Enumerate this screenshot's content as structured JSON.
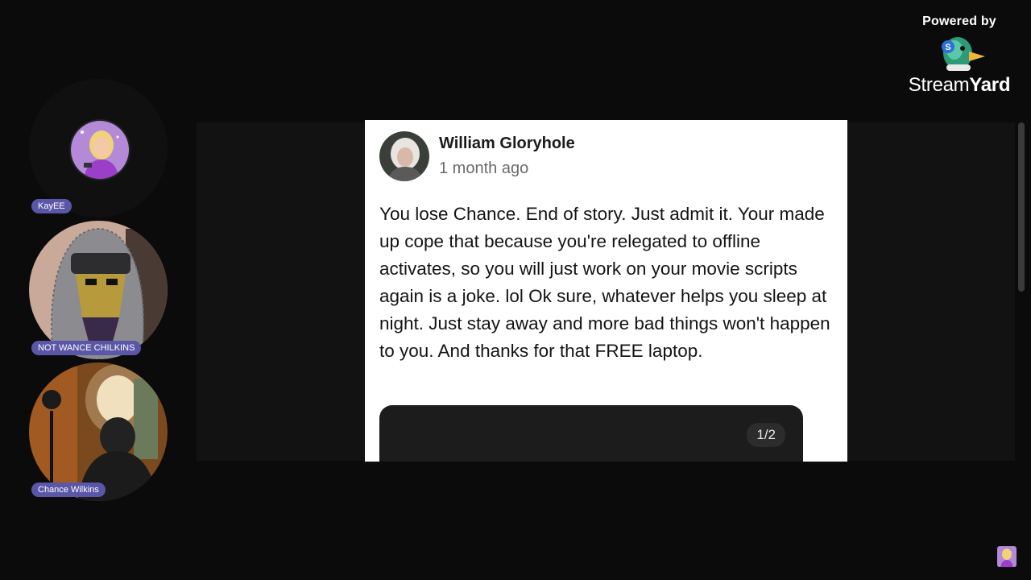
{
  "branding": {
    "powered_by": "Powered by",
    "name_regular": "Stream",
    "name_bold": "Yard",
    "logo_icon": "streamyard-duck-icon"
  },
  "participants": [
    {
      "name": "KayEE",
      "avatar": "cartoon-woman-avatar"
    },
    {
      "name": "NOT WANCE CHILKINS",
      "avatar": "helmet-mask-camera"
    },
    {
      "name": "Chance Wilkins",
      "avatar": "dim-room-camera"
    }
  ],
  "post": {
    "author": "William Gloryhole",
    "time": "1 month ago",
    "body": "You lose Chance. End of story. Just admit it. Your made up cope that because you're relegated to offline activates, so you will just work on your movie scripts again is a joke. lol Ok sure, whatever helps you sleep at night. Just stay away and more bad things won't happen to you. And thanks for that FREE laptop.",
    "pager": "1/2"
  },
  "colors": {
    "background": "#0b0b0b",
    "name_badge": "#5b57a8",
    "card": "#ffffff"
  }
}
